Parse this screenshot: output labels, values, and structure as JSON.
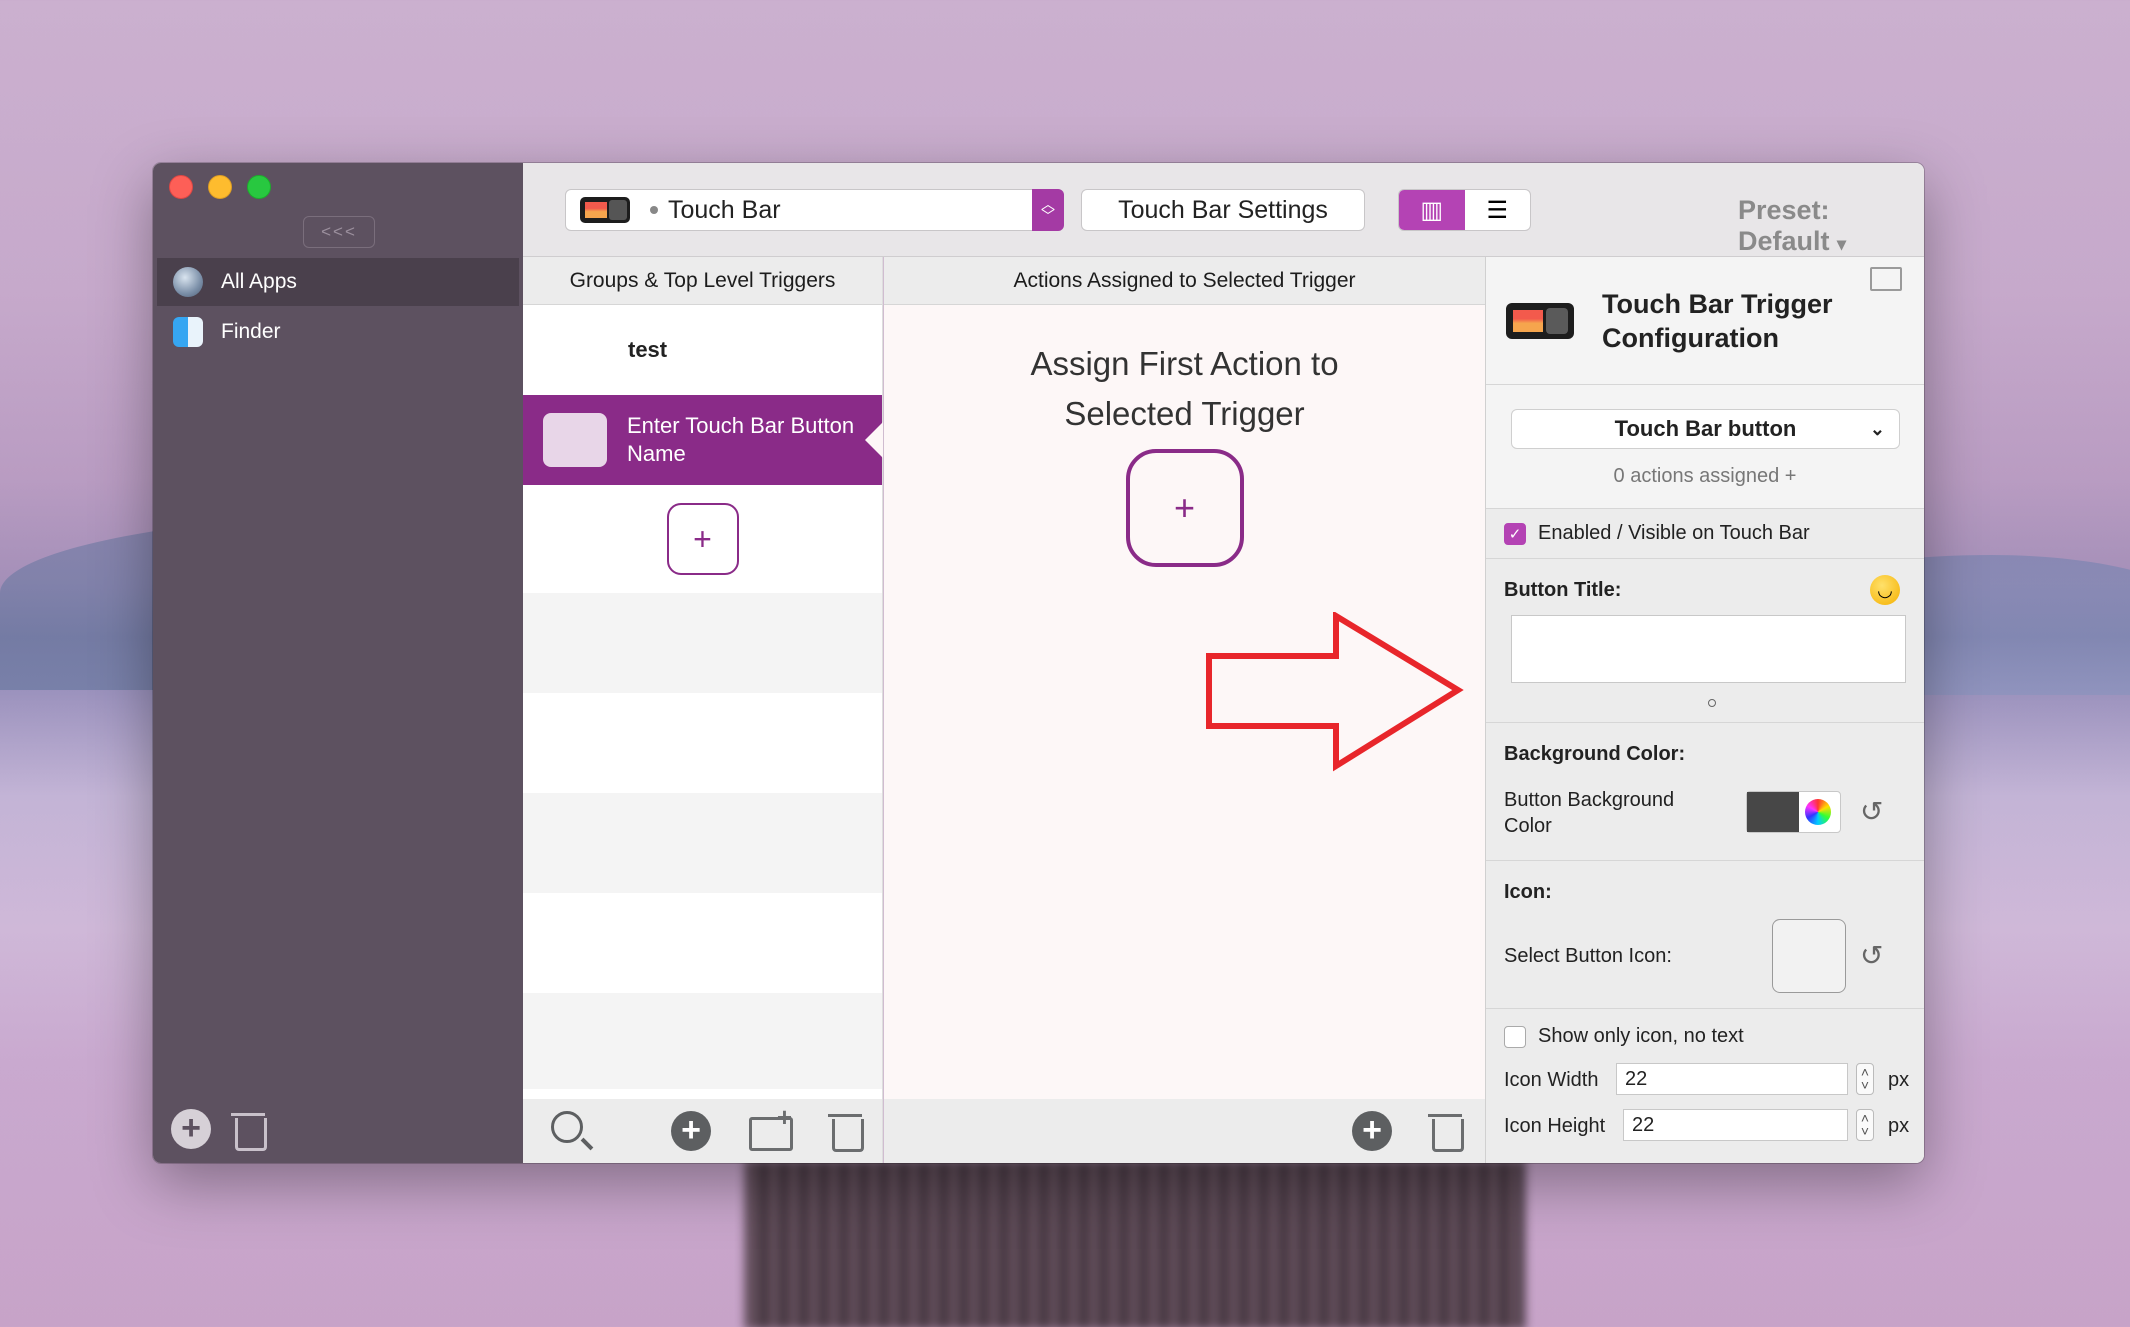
{
  "sidebar": {
    "collapse_label": "<<<",
    "items": [
      {
        "label": "All Apps",
        "icon": "globe-icon",
        "selected": true
      },
      {
        "label": "Finder",
        "icon": "finder-icon",
        "selected": false
      }
    ]
  },
  "toolbar": {
    "mode_select": "Touch Bar",
    "settings_button": "Touch Bar Settings",
    "view_toggle": [
      "column-view-icon",
      "list-view-icon"
    ],
    "preset_label": "Preset: Default",
    "preset_arrow": "▾"
  },
  "triggers": {
    "header": "Groups & Top Level Triggers",
    "items": [
      {
        "label": "test",
        "selected": false
      },
      {
        "label": "Enter Touch Bar Button Name",
        "selected": true
      }
    ],
    "add_symbol": "+"
  },
  "actions": {
    "header": "Actions Assigned to Selected Trigger",
    "empty_title_line1": "Assign First Action to",
    "empty_title_line2": "Selected Trigger",
    "add_symbol": "+"
  },
  "config": {
    "title": "Touch Bar Trigger Configuration",
    "trigger_type": "Touch Bar button",
    "actions_assigned": "0 actions assigned +",
    "enabled_label": "Enabled / Visible on Touch Bar",
    "enabled": true,
    "button_title_label": "Button Title:",
    "button_title_value": "",
    "background_section": "Background Color:",
    "background_label": "Button Background Color",
    "background_color": "#474747",
    "icon_section": "Icon:",
    "select_icon_label": "Select Button Icon:",
    "show_only_icon_label": "Show only icon, no text",
    "show_only_icon": false,
    "icon_width_label": "Icon Width",
    "icon_width": "22",
    "icon_height_label": "Icon Height",
    "icon_height": "22",
    "unit": "px"
  },
  "colors": {
    "accent": "#8a2b88",
    "accent_light": "#b443b4",
    "sidebar_bg": "#5d5160",
    "arrow": "#e8262b"
  }
}
